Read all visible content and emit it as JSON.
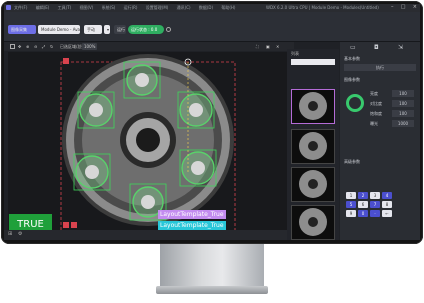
{
  "window": {
    "title": "WDX 6.2.0 Ultra CPU | Module Demo - Modules(Untitled)",
    "menu": [
      "文件(F)",
      "编辑(E)",
      "工具(T)",
      "视图(V)",
      "系统(S)",
      "运行(R)",
      "设置管理(M)",
      "通讯(C)",
      "数据(D)",
      "帮助(H)"
    ]
  },
  "toolbar": {
    "module_label": "图像采集",
    "solution_name": "Module Demo - Ava...",
    "mode_label": "手动",
    "run_label": "运行",
    "status_label": "运行状态 : 0.0"
  },
  "image_toolbar": {
    "zoom": "100%",
    "tool_label": "已选区域/总数量"
  },
  "result": {
    "badge": "TRUE",
    "labels": [
      "LayoutTemplate_True",
      "LayoutTemplate_True"
    ]
  },
  "thumbs": {
    "header": "列表",
    "count": 4
  },
  "right_panel": {
    "section1": "基本参数",
    "button_run": "执行",
    "section2": "图像参数",
    "fields": [
      {
        "label": "亮度",
        "value": "100"
      },
      {
        "label": "对比度",
        "value": "100"
      },
      {
        "label": "饱和度",
        "value": "100"
      },
      {
        "label": "曝光",
        "value": "1000"
      }
    ],
    "section3": "高级参数",
    "grid_buttons": [
      "1",
      "2",
      "3",
      "4",
      "5",
      "6",
      "7",
      "8",
      "9",
      "0",
      "·",
      "←"
    ]
  },
  "colors": {
    "accent_purple": "#6d6ee6",
    "ok_green": "#1fa03a",
    "tag_purple": "#c38cf0",
    "tag_cyan": "#28c7d9"
  }
}
